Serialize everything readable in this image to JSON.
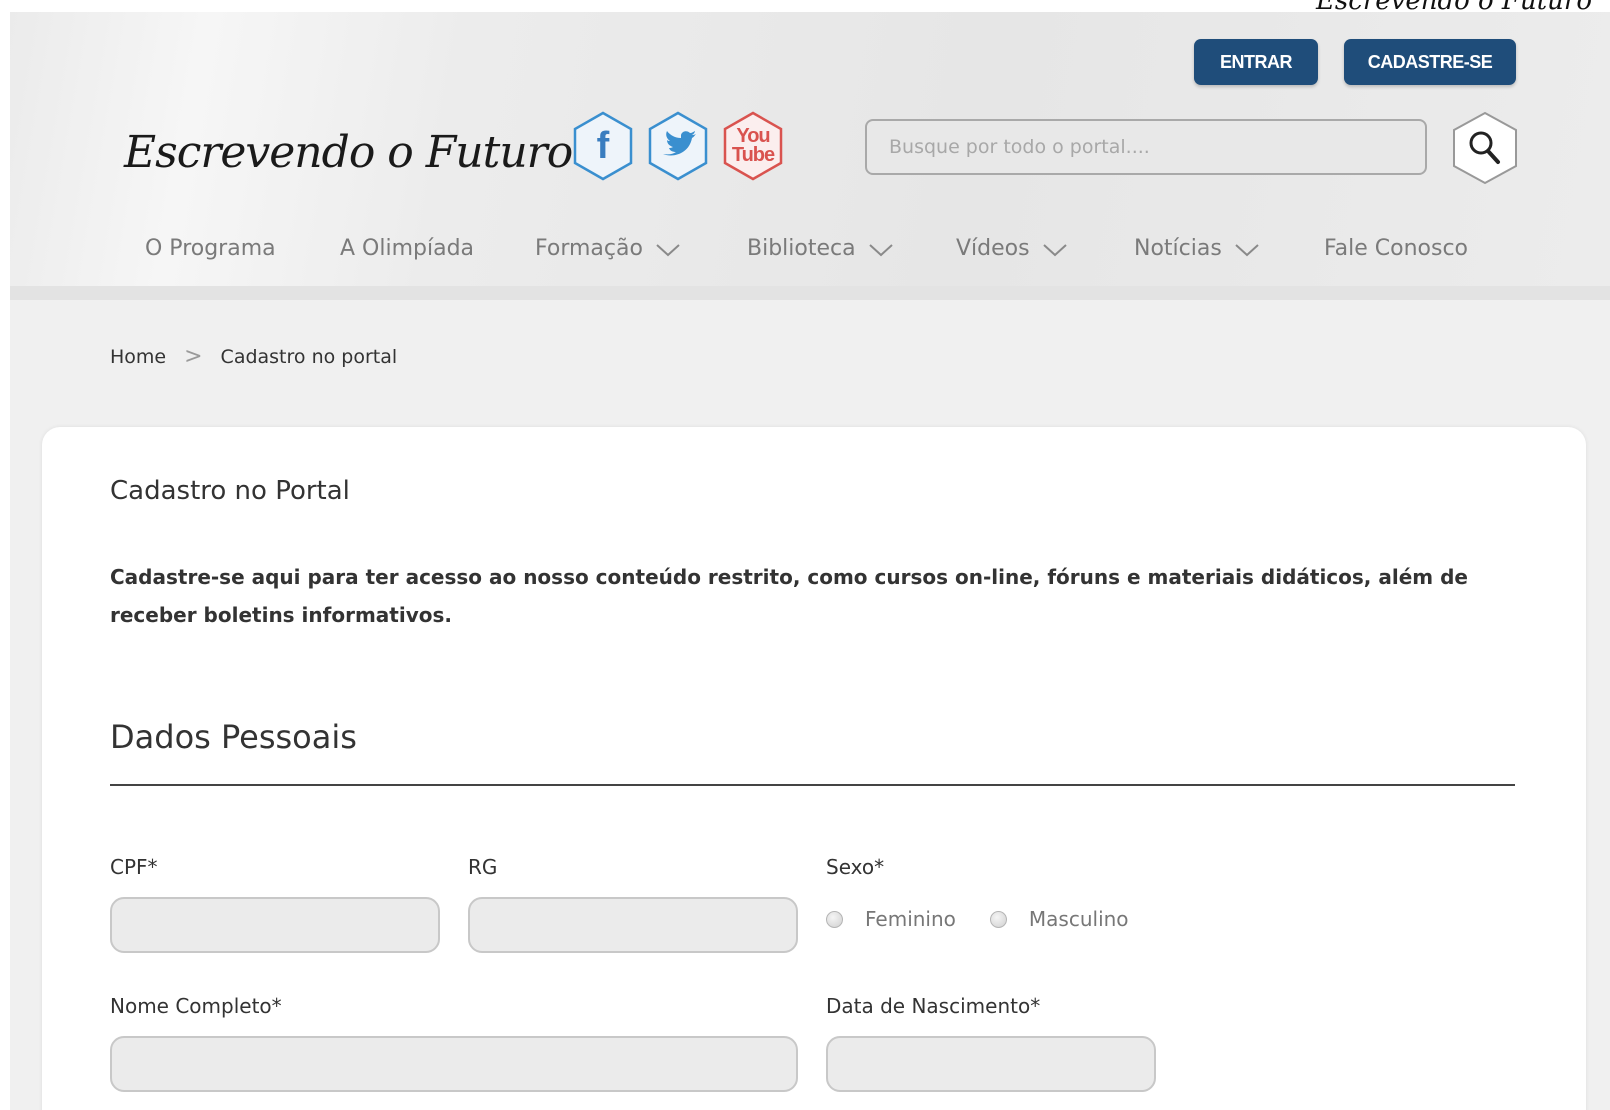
{
  "corner_text": "Escrevendo o Futuro",
  "header": {
    "buttons": {
      "login": "ENTRAR",
      "signup": "CADASTRE-SE"
    },
    "logo_text": "Escrevendo o Futuro",
    "social": {
      "facebook": "f",
      "youtube_top": "You",
      "youtube_bottom": "Tube"
    },
    "search": {
      "placeholder": "Busque por todo o portal....",
      "value": ""
    },
    "nav": [
      {
        "label": "O Programa"
      },
      {
        "label": "A Olimpíada"
      },
      {
        "label": "Formação"
      },
      {
        "label": "Biblioteca"
      },
      {
        "label": "Vídeos"
      },
      {
        "label": "Notícias"
      },
      {
        "label": "Fale Conosco"
      }
    ]
  },
  "breadcrumb": {
    "home": "Home",
    "separator": ">",
    "current": "Cadastro no portal"
  },
  "page": {
    "title": "Cadastro no Portal",
    "description": "Cadastre-se aqui para ter acesso ao nosso conteúdo restrito, como cursos on-line, fóruns e materiais didáticos, além de receber boletins informativos.",
    "section_title": "Dados Pessoais"
  },
  "form": {
    "cpf_label": "CPF*",
    "rg_label": "RG",
    "sexo_label": "Sexo*",
    "sexo_options": [
      "Feminino",
      "Masculino"
    ],
    "nome_label": "Nome Completo*",
    "nascimento_label": "Data de Nascimento*"
  },
  "colors": {
    "primary_button": "#1f4d7a",
    "youtube_red": "#d9534f",
    "social_blue": "#3a8fcf"
  }
}
